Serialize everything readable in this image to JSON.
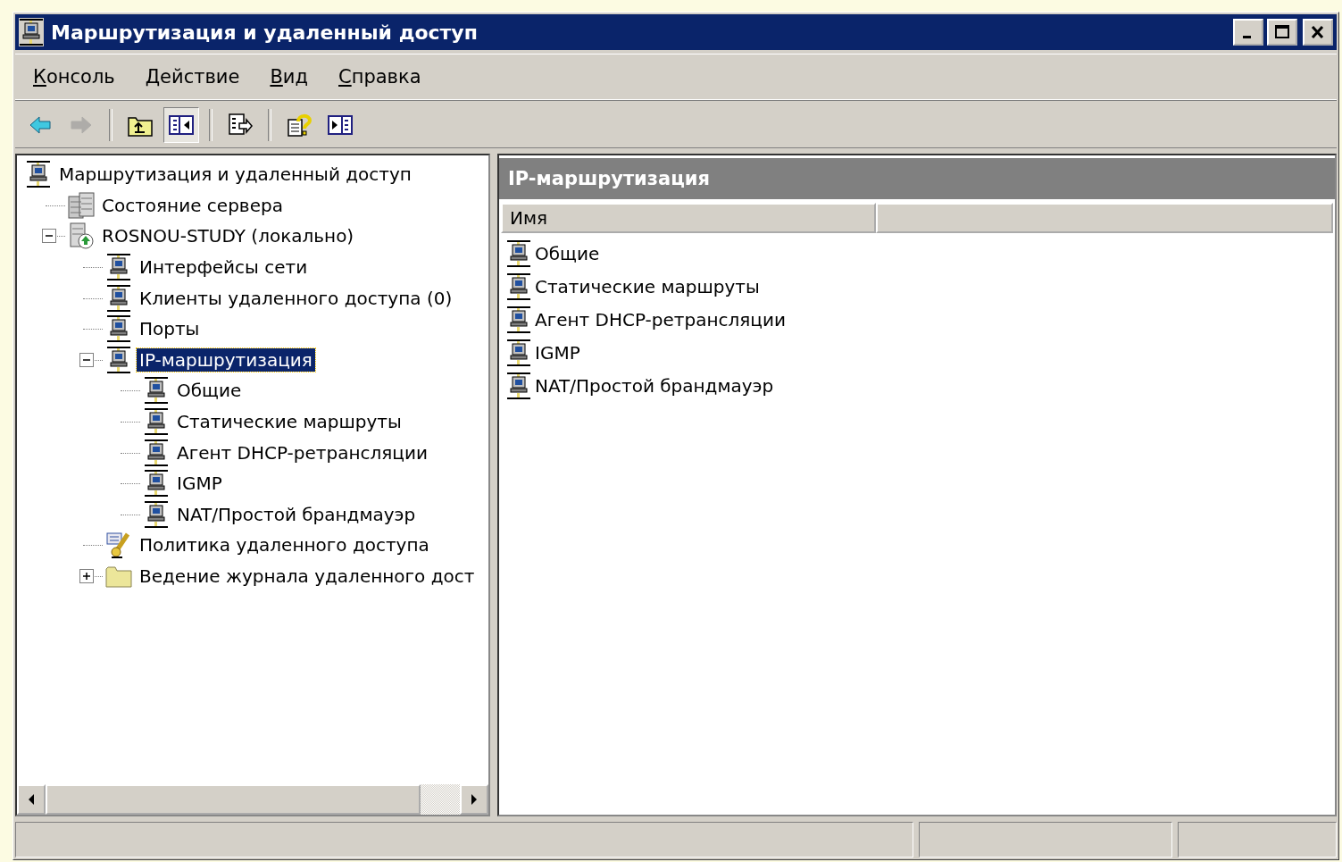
{
  "window": {
    "title": "Маршрутизация и удаленный доступ"
  },
  "menu": [
    {
      "label": "Консоль"
    },
    {
      "label": "Действие"
    },
    {
      "label": "Вид"
    },
    {
      "label": "Справка"
    }
  ],
  "toolbar": [
    {
      "kind": "back",
      "disabled": false,
      "pressed": false
    },
    {
      "kind": "forward",
      "disabled": true,
      "pressed": false
    },
    {
      "kind": "separator"
    },
    {
      "kind": "up",
      "disabled": false,
      "pressed": false
    },
    {
      "kind": "tree",
      "disabled": false,
      "pressed": true
    },
    {
      "kind": "separator"
    },
    {
      "kind": "export",
      "disabled": false,
      "pressed": false
    },
    {
      "kind": "separator"
    },
    {
      "kind": "help",
      "disabled": false,
      "pressed": false
    },
    {
      "kind": "pane",
      "disabled": false,
      "pressed": false
    }
  ],
  "tree": [
    {
      "label": "Маршрутизация и удаленный доступ",
      "kind": "network",
      "selected": false,
      "children": [
        {
          "label": "Состояние сервера",
          "kind": "server",
          "selected": false
        },
        {
          "label": "ROSNOU-STUDY (локально)",
          "kind": "local-server",
          "selected": false,
          "expanded": true,
          "children": [
            {
              "label": "Интерфейсы сети",
              "kind": "network",
              "selected": false
            },
            {
              "label": "Клиенты удаленного доступа (0)",
              "kind": "network",
              "selected": false
            },
            {
              "label": "Порты",
              "kind": "network",
              "selected": false
            },
            {
              "label": "IP-маршрутизация",
              "kind": "network",
              "selected": true,
              "expanded": true,
              "children": [
                {
                  "label": "Общие",
                  "kind": "network",
                  "selected": false
                },
                {
                  "label": "Статические маршруты",
                  "kind": "network",
                  "selected": false
                },
                {
                  "label": "Агент DHCP-ретрансляции",
                  "kind": "network",
                  "selected": false
                },
                {
                  "label": "IGMP",
                  "kind": "network",
                  "selected": false
                },
                {
                  "label": "NAT/Простой брандмауэр",
                  "kind": "network",
                  "selected": false
                }
              ]
            },
            {
              "label": "Политика удаленного доступа",
              "kind": "policy",
              "selected": false
            },
            {
              "label": "Ведение журнала удаленного дост",
              "kind": "folder",
              "selected": false,
              "expanded": false
            }
          ]
        }
      ]
    }
  ],
  "details": {
    "title": "IP-маршрутизация",
    "columns": [
      {
        "label": "Имя"
      }
    ],
    "items": [
      {
        "label": "Общие",
        "kind": "network",
        "selected": false
      },
      {
        "label": "Статические маршруты",
        "kind": "network",
        "selected": false
      },
      {
        "label": "Агент DHCP-ретрансляции",
        "kind": "network",
        "selected": false
      },
      {
        "label": "IGMP",
        "kind": "network",
        "selected": false
      },
      {
        "label": "NAT/Простой брандмауэр",
        "kind": "network",
        "selected": false
      }
    ]
  }
}
